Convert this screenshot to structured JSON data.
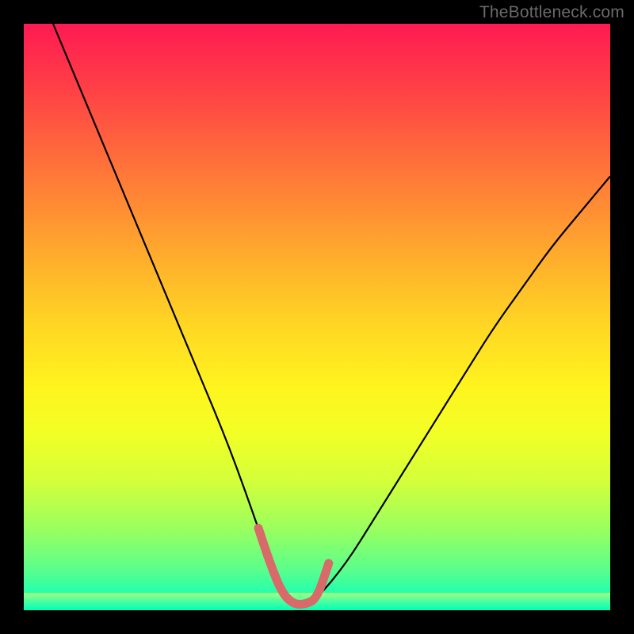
{
  "watermark": "TheBottleneck.com",
  "colors": {
    "frame": "#000000",
    "curve_main": "#000000",
    "curve_highlight": "#d96a6a",
    "gradient_top": "#ff1a52",
    "gradient_bottom": "#00ffcc"
  },
  "chart_data": {
    "type": "line",
    "title": "",
    "xlabel": "",
    "ylabel": "",
    "xlim": [
      0,
      100
    ],
    "ylim": [
      0,
      100
    ],
    "series": [
      {
        "name": "bottleneck-curve",
        "x": [
          5,
          10,
          15,
          20,
          25,
          30,
          35,
          40,
          42,
          45,
          48,
          50,
          55,
          60,
          65,
          70,
          75,
          80,
          85,
          90,
          95,
          100
        ],
        "y": [
          100,
          88,
          76,
          64,
          52,
          40,
          28,
          14,
          8,
          2,
          1,
          2,
          8,
          16,
          24,
          32,
          40,
          48,
          55,
          62,
          68,
          74
        ]
      }
    ],
    "highlight": {
      "x": [
        40,
        42,
        44,
        46,
        48,
        50,
        52
      ],
      "y": [
        14,
        8,
        3,
        1,
        1,
        2,
        8
      ],
      "note": "thick salmon segment near trough"
    },
    "grid": false,
    "legend": false
  }
}
